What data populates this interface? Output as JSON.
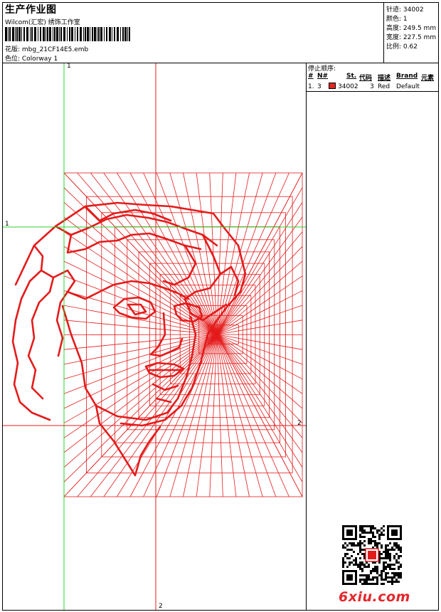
{
  "header": {
    "title": "生产作业图",
    "company": "Wilcom(汇宏) 绣饰工作室",
    "design_label": "花版: mbg_21CF14E5.emb",
    "colorway_label": "色位: Colorway 1"
  },
  "specs": [
    {
      "label": "针迹:",
      "value": "34002"
    },
    {
      "label": "颜色:",
      "value": "1"
    },
    {
      "label": "高度:",
      "value": "249.5 mm"
    },
    {
      "label": "宽度:",
      "value": "227.5 mm"
    },
    {
      "label": "比例:",
      "value": "0.62"
    }
  ],
  "stop_sequence": {
    "title": "停止顺序:",
    "headers": [
      "#",
      "N#",
      "St.",
      "代码",
      "描述",
      "Brand",
      "元素"
    ],
    "rows": [
      {
        "num": "1.",
        "needle": "3",
        "stitches": "34002",
        "code": "3",
        "description": "Red",
        "brand": "Default",
        "color": "#e32323"
      }
    ]
  },
  "axes": {
    "v1": "1",
    "h1": "1",
    "v2": "2",
    "h2": "2"
  },
  "watermark": "6xiu.com",
  "colors": {
    "thread": "#e41b1b",
    "guide_green": "#2bd12b",
    "guide_red": "#e41b1b"
  }
}
